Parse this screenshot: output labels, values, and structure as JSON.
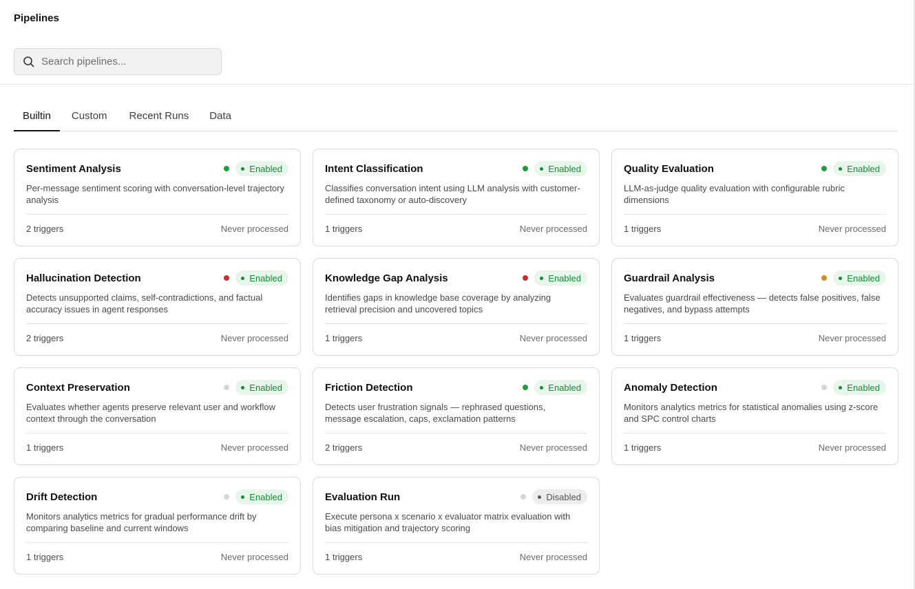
{
  "page": {
    "title": "Pipelines"
  },
  "search": {
    "placeholder": "Search pipelines..."
  },
  "tabs": [
    {
      "label": "Builtin",
      "active": true
    },
    {
      "label": "Custom",
      "active": false
    },
    {
      "label": "Recent Runs",
      "active": false
    },
    {
      "label": "Data",
      "active": false
    }
  ],
  "colors": {
    "health_green": "#1f9d3c",
    "health_red": "#cc2b2b",
    "health_orange": "#d98b12",
    "health_gray": "#d6d6d6",
    "enabled_bg": "#e8f5ea",
    "enabled_text": "#178a36",
    "disabled_bg": "#ececec",
    "disabled_text": "#555555"
  },
  "pipelines": [
    {
      "name": "Sentiment Analysis",
      "health": "green",
      "status": "Enabled",
      "description": "Per-message sentiment scoring with conversation-level trajectory analysis",
      "triggers": "2 triggers",
      "last_processed": "Never processed"
    },
    {
      "name": "Intent Classification",
      "health": "green",
      "status": "Enabled",
      "description": "Classifies conversation intent using LLM analysis with customer-defined taxonomy or auto-discovery",
      "triggers": "1 triggers",
      "last_processed": "Never processed"
    },
    {
      "name": "Quality Evaluation",
      "health": "green",
      "status": "Enabled",
      "description": "LLM-as-judge quality evaluation with configurable rubric dimensions",
      "triggers": "1 triggers",
      "last_processed": "Never processed"
    },
    {
      "name": "Hallucination Detection",
      "health": "red",
      "status": "Enabled",
      "description": "Detects unsupported claims, self-contradictions, and factual accuracy issues in agent responses",
      "triggers": "2 triggers",
      "last_processed": "Never processed"
    },
    {
      "name": "Knowledge Gap Analysis",
      "health": "red",
      "status": "Enabled",
      "description": "Identifies gaps in knowledge base coverage by analyzing retrieval precision and uncovered topics",
      "triggers": "1 triggers",
      "last_processed": "Never processed"
    },
    {
      "name": "Guardrail Analysis",
      "health": "orange",
      "status": "Enabled",
      "description": "Evaluates guardrail effectiveness — detects false positives, false negatives, and bypass attempts",
      "triggers": "1 triggers",
      "last_processed": "Never processed"
    },
    {
      "name": "Context Preservation",
      "health": "gray",
      "status": "Enabled",
      "description": "Evaluates whether agents preserve relevant user and workflow context through the conversation",
      "triggers": "1 triggers",
      "last_processed": "Never processed"
    },
    {
      "name": "Friction Detection",
      "health": "green",
      "status": "Enabled",
      "description": "Detects user frustration signals — rephrased questions, message escalation, caps, exclamation patterns",
      "triggers": "2 triggers",
      "last_processed": "Never processed"
    },
    {
      "name": "Anomaly Detection",
      "health": "gray",
      "status": "Enabled",
      "description": "Monitors analytics metrics for statistical anomalies using z-score and SPC control charts",
      "triggers": "1 triggers",
      "last_processed": "Never processed"
    },
    {
      "name": "Drift Detection",
      "health": "gray",
      "status": "Enabled",
      "description": "Monitors analytics metrics for gradual performance drift by comparing baseline and current windows",
      "triggers": "1 triggers",
      "last_processed": "Never processed"
    },
    {
      "name": "Evaluation Run",
      "health": "gray",
      "status": "Disabled",
      "description": "Execute persona x scenario x evaluator matrix evaluation with bias mitigation and trajectory scoring",
      "triggers": "1 triggers",
      "last_processed": "Never processed"
    }
  ]
}
